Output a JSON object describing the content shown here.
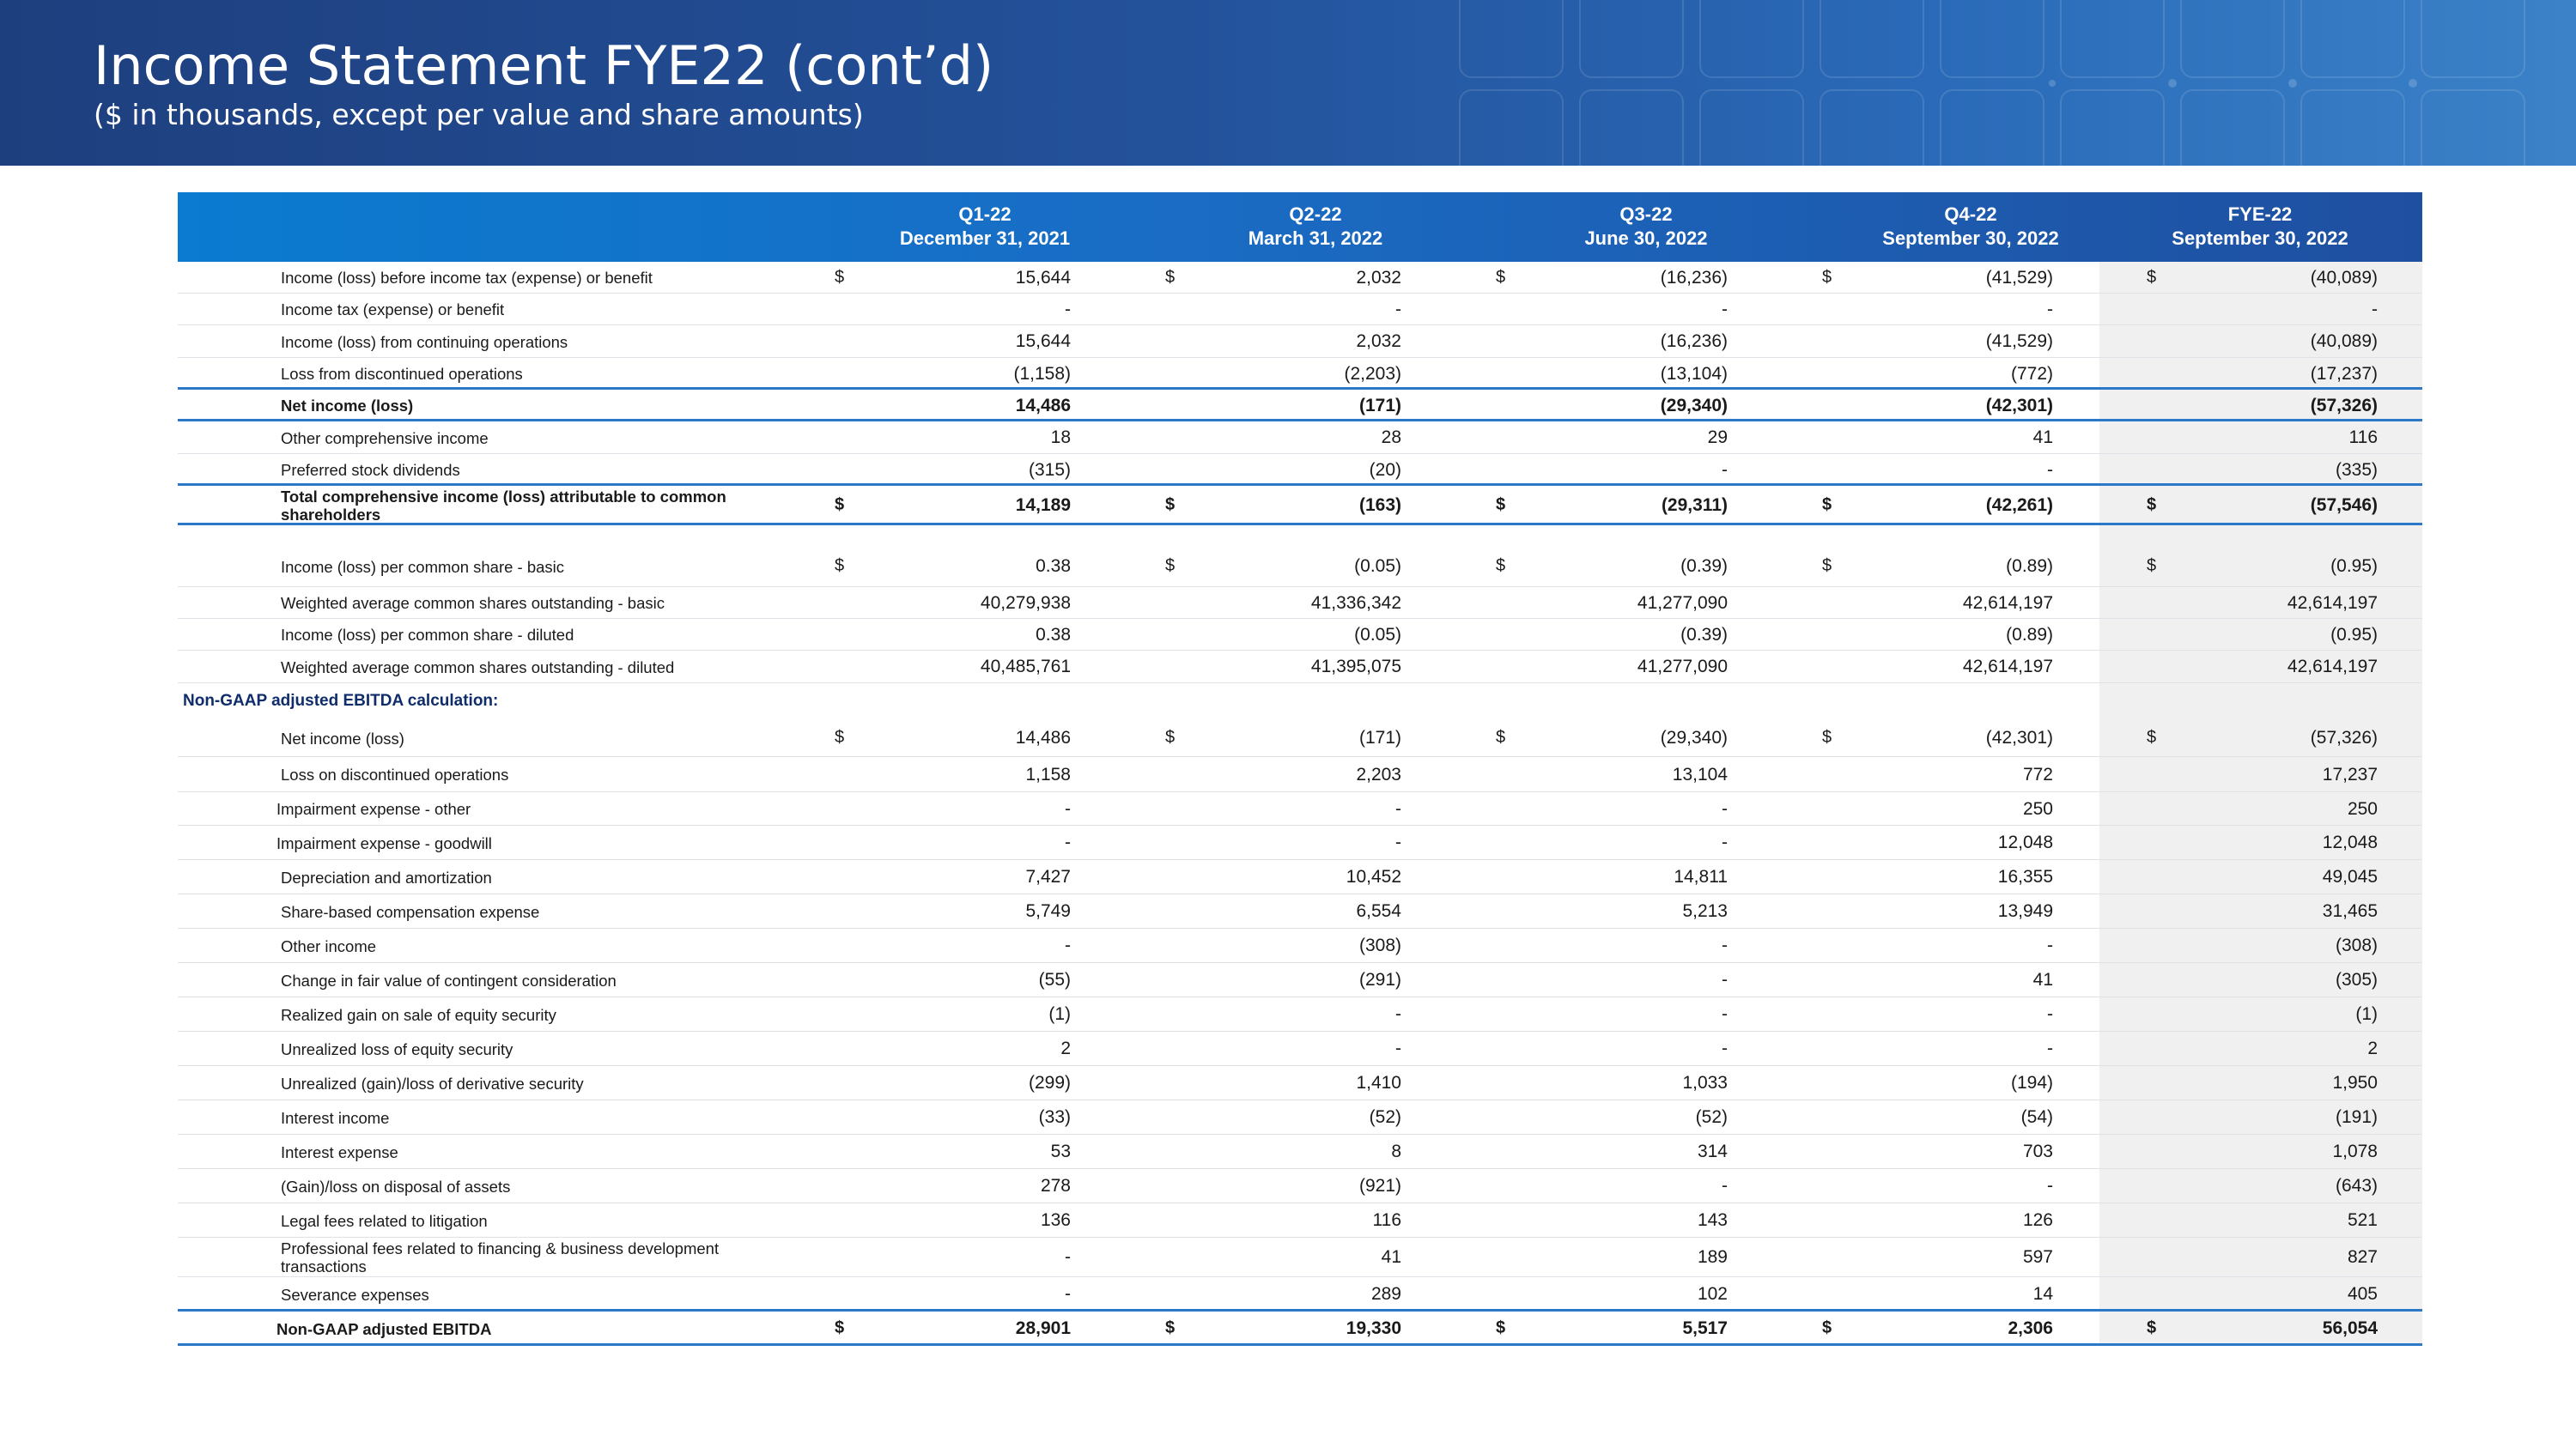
{
  "header": {
    "title": "Income Statement FYE22 (cont’d)",
    "subtitle": "($ in thousands, except per value and share amounts)"
  },
  "colors": {
    "banner": "#23519a",
    "table_header": "#1a6cc4",
    "rule": "#2a78c6",
    "section_text": "#0f2d6b"
  },
  "columns": [
    {
      "period": "Q1-22",
      "date": "December 31, 2021"
    },
    {
      "period": "Q2-22",
      "date": "March 31, 2022"
    },
    {
      "period": "Q3-22",
      "date": "June 30, 2022"
    },
    {
      "period": "Q4-22",
      "date": "September 30, 2022"
    },
    {
      "period": "FYE-22",
      "date": "September 30, 2022"
    }
  ],
  "rows": [
    {
      "label": "Income (loss) before income tax (expense) or benefit",
      "dollar": true,
      "values": [
        "15,644",
        "2,032",
        "(16,236)",
        "(41,529)",
        "(40,089)"
      ]
    },
    {
      "label": "Income tax (expense) or benefit",
      "values": [
        "-",
        "-",
        "-",
        "-",
        "-"
      ]
    },
    {
      "label": "Income (loss) from continuing operations",
      "values": [
        "15,644",
        "2,032",
        "(16,236)",
        "(41,529)",
        "(40,089)"
      ]
    },
    {
      "label": "Loss from discontinued operations",
      "values": [
        "(1,158)",
        "(2,203)",
        "(13,104)",
        "(772)",
        "(17,237)"
      ]
    },
    {
      "label": "Net income (loss)",
      "bold": true,
      "values": [
        "14,486",
        "(171)",
        "(29,340)",
        "(42,301)",
        "(57,326)"
      ]
    },
    {
      "label": "Other comprehensive income",
      "values": [
        "18",
        "28",
        "29",
        "41",
        "116"
      ]
    },
    {
      "label": "Preferred stock dividends",
      "values": [
        "(315)",
        "(20)",
        "-",
        "-",
        "(335)"
      ]
    },
    {
      "label": "Total comprehensive income (loss) attributable to common shareholders",
      "bold": true,
      "dollar": true,
      "values": [
        "14,189",
        "(163)",
        "(29,311)",
        "(42,261)",
        "(57,546)"
      ]
    },
    {
      "label": "Income (loss) per common share - basic",
      "dollar": true,
      "values": [
        "0.38",
        "(0.05)",
        "(0.39)",
        "(0.89)",
        "(0.95)"
      ]
    },
    {
      "label": "Weighted average common shares outstanding - basic",
      "values": [
        "40,279,938",
        "41,336,342",
        "41,277,090",
        "42,614,197",
        "42,614,197"
      ]
    },
    {
      "label": "Income (loss) per common share - diluted",
      "values": [
        "0.38",
        "(0.05)",
        "(0.39)",
        "(0.89)",
        "(0.95)"
      ]
    },
    {
      "label": "Weighted average common shares outstanding - diluted",
      "values": [
        "40,485,761",
        "41,395,075",
        "41,277,090",
        "42,614,197",
        "42,614,197"
      ]
    },
    {
      "label": "Net income (loss)",
      "dollar": true,
      "values": [
        "14,486",
        "(171)",
        "(29,340)",
        "(42,301)",
        "(57,326)"
      ]
    },
    {
      "label": "Loss on discontinued operations",
      "values": [
        "1,158",
        "2,203",
        "13,104",
        "772",
        "17,237"
      ]
    },
    {
      "label": "Impairment expense - other",
      "values": [
        "-",
        "-",
        "-",
        "250",
        "250"
      ]
    },
    {
      "label": "Impairment expense - goodwill",
      "values": [
        "-",
        "-",
        "-",
        "12,048",
        "12,048"
      ]
    },
    {
      "label": "Depreciation and amortization",
      "values": [
        "7,427",
        "10,452",
        "14,811",
        "16,355",
        "49,045"
      ]
    },
    {
      "label": "Share-based compensation expense",
      "values": [
        "5,749",
        "6,554",
        "5,213",
        "13,949",
        "31,465"
      ]
    },
    {
      "label": "Other income",
      "values": [
        "-",
        "(308)",
        "-",
        "-",
        "(308)"
      ]
    },
    {
      "label": "Change in fair value of contingent consideration",
      "values": [
        "(55)",
        "(291)",
        "-",
        "41",
        "(305)"
      ]
    },
    {
      "label": "Realized gain on sale of equity security",
      "values": [
        "(1)",
        "-",
        "-",
        "-",
        "(1)"
      ]
    },
    {
      "label": "Unrealized loss of equity security",
      "values": [
        "2",
        "-",
        "-",
        "-",
        "2"
      ]
    },
    {
      "label": "Unrealized (gain)/loss of derivative security",
      "values": [
        "(299)",
        "1,410",
        "1,033",
        "(194)",
        "1,950"
      ]
    },
    {
      "label": "Interest income",
      "values": [
        "(33)",
        "(52)",
        "(52)",
        "(54)",
        "(191)"
      ]
    },
    {
      "label": "Interest expense",
      "values": [
        "53",
        "8",
        "314",
        "703",
        "1,078"
      ]
    },
    {
      "label": "(Gain)/loss on disposal of assets",
      "values": [
        "278",
        "(921)",
        "-",
        "-",
        "(643)"
      ]
    },
    {
      "label": "Legal fees related to litigation",
      "values": [
        "136",
        "116",
        "143",
        "126",
        "521"
      ]
    },
    {
      "label": "Professional fees related to financing & business development transactions",
      "values": [
        "-",
        "41",
        "189",
        "597",
        "827"
      ]
    },
    {
      "label": "Severance expenses",
      "values": [
        "-",
        "289",
        "102",
        "14",
        "405"
      ]
    },
    {
      "label": "Non-GAAP adjusted EBITDA",
      "bold": true,
      "dollar": true,
      "values": [
        "28,901",
        "19,330",
        "5,517",
        "2,306",
        "56,054"
      ]
    }
  ],
  "section_label": "Non-GAAP adjusted EBITDA calculation:",
  "dollar_sign": "$"
}
